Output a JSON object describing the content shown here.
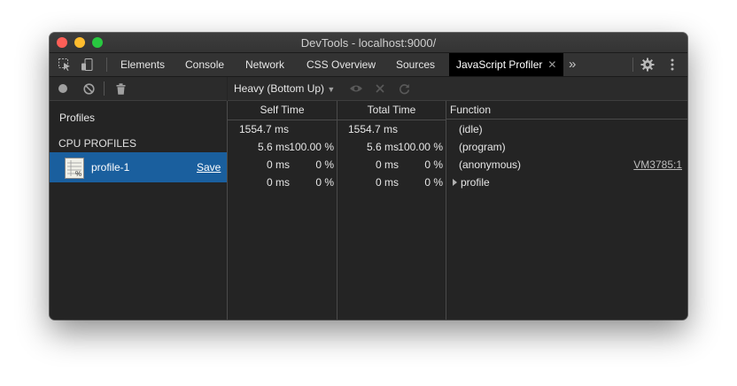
{
  "window": {
    "title": "DevTools - localhost:9000/"
  },
  "tabs": [
    {
      "label": "Elements"
    },
    {
      "label": "Console"
    },
    {
      "label": "Network"
    },
    {
      "label": "CSS Overview"
    },
    {
      "label": "Sources"
    },
    {
      "label": "JavaScript Profiler",
      "active": true
    }
  ],
  "overflow_label": "»",
  "sidebar": {
    "profiles_title": "Profiles",
    "cpu_profiles_title": "CPU PROFILES",
    "items": [
      {
        "name": "profile-1",
        "save_label": "Save"
      }
    ]
  },
  "main": {
    "view_select": "Heavy (Bottom Up)",
    "columns": {
      "self_time": "Self Time",
      "total_time": "Total Time",
      "function": "Function"
    },
    "rows": [
      {
        "self_ms": "1554.7 ms",
        "self_pct": "",
        "total_ms": "1554.7 ms",
        "total_pct": "",
        "function": "(idle)",
        "source": "",
        "expandable": false
      },
      {
        "self_ms": "5.6 ms",
        "self_pct": "100.00 %",
        "total_ms": "5.6 ms",
        "total_pct": "100.00 %",
        "function": "(program)",
        "source": "",
        "expandable": false
      },
      {
        "self_ms": "0 ms",
        "self_pct": "0 %",
        "total_ms": "0 ms",
        "total_pct": "0 %",
        "function": "(anonymous)",
        "source": "VM3785:1",
        "expandable": false
      },
      {
        "self_ms": "0 ms",
        "self_pct": "0 %",
        "total_ms": "0 ms",
        "total_pct": "0 %",
        "function": "profile",
        "source": "",
        "expandable": true
      }
    ]
  },
  "colors": {
    "accent": "#1a5f9e",
    "background": "#242424",
    "toolbar": "#333333"
  }
}
